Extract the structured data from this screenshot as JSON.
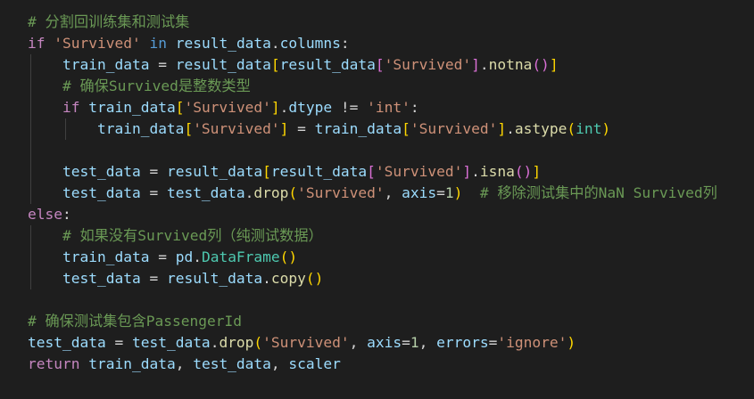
{
  "editor": {
    "language": "python",
    "theme": "dark",
    "colors": {
      "background": "#1e1e1e",
      "keyword": "#569cd6",
      "control": "#c586c0",
      "string": "#ce9178",
      "number": "#b5cea8",
      "variable": "#9cdcfe",
      "function": "#dcdcaa",
      "class": "#4ec9b0",
      "comment": "#6a9955",
      "bracket_level1": "#ffd700",
      "bracket_level2": "#da70d6"
    },
    "lines": [
      {
        "tokens": [
          {
            "t": "# 分割回训练集和测试集",
            "c": "cmt"
          }
        ]
      },
      {
        "tokens": [
          {
            "t": "if",
            "c": "ctl"
          },
          {
            "t": " ",
            "c": "op"
          },
          {
            "t": "'Survived'",
            "c": "str"
          },
          {
            "t": " ",
            "c": "op"
          },
          {
            "t": "in",
            "c": "kw"
          },
          {
            "t": " ",
            "c": "op"
          },
          {
            "t": "result_data",
            "c": "var"
          },
          {
            "t": ".",
            "c": "op"
          },
          {
            "t": "columns",
            "c": "var"
          },
          {
            "t": ":",
            "c": "op"
          }
        ]
      },
      {
        "tokens": [
          {
            "t": "    ",
            "c": "op"
          },
          {
            "t": "train_data",
            "c": "var"
          },
          {
            "t": " = ",
            "c": "op"
          },
          {
            "t": "result_data",
            "c": "var"
          },
          {
            "t": "[",
            "c": "b1"
          },
          {
            "t": "result_data",
            "c": "var"
          },
          {
            "t": "[",
            "c": "b2"
          },
          {
            "t": "'Survived'",
            "c": "str"
          },
          {
            "t": "]",
            "c": "b2"
          },
          {
            "t": ".",
            "c": "op"
          },
          {
            "t": "notna",
            "c": "fn"
          },
          {
            "t": "()",
            "c": "b2"
          },
          {
            "t": "]",
            "c": "b1"
          }
        ]
      },
      {
        "tokens": [
          {
            "t": "    ",
            "c": "op"
          },
          {
            "t": "# 确保Survived是整数类型",
            "c": "cmt"
          }
        ]
      },
      {
        "tokens": [
          {
            "t": "    ",
            "c": "op"
          },
          {
            "t": "if",
            "c": "ctl"
          },
          {
            "t": " ",
            "c": "op"
          },
          {
            "t": "train_data",
            "c": "var"
          },
          {
            "t": "[",
            "c": "b1"
          },
          {
            "t": "'Survived'",
            "c": "str"
          },
          {
            "t": "]",
            "c": "b1"
          },
          {
            "t": ".",
            "c": "op"
          },
          {
            "t": "dtype",
            "c": "var"
          },
          {
            "t": " != ",
            "c": "op"
          },
          {
            "t": "'int'",
            "c": "str"
          },
          {
            "t": ":",
            "c": "op"
          }
        ]
      },
      {
        "tokens": [
          {
            "t": "        ",
            "c": "op"
          },
          {
            "t": "train_data",
            "c": "var"
          },
          {
            "t": "[",
            "c": "b1"
          },
          {
            "t": "'Survived'",
            "c": "str"
          },
          {
            "t": "]",
            "c": "b1"
          },
          {
            "t": " = ",
            "c": "op"
          },
          {
            "t": "train_data",
            "c": "var"
          },
          {
            "t": "[",
            "c": "b1"
          },
          {
            "t": "'Survived'",
            "c": "str"
          },
          {
            "t": "]",
            "c": "b1"
          },
          {
            "t": ".",
            "c": "op"
          },
          {
            "t": "astype",
            "c": "fn"
          },
          {
            "t": "(",
            "c": "b1"
          },
          {
            "t": "int",
            "c": "cls"
          },
          {
            "t": ")",
            "c": "b1"
          }
        ]
      },
      {
        "tokens": []
      },
      {
        "tokens": [
          {
            "t": "    ",
            "c": "op"
          },
          {
            "t": "test_data",
            "c": "var"
          },
          {
            "t": " = ",
            "c": "op"
          },
          {
            "t": "result_data",
            "c": "var"
          },
          {
            "t": "[",
            "c": "b1"
          },
          {
            "t": "result_data",
            "c": "var"
          },
          {
            "t": "[",
            "c": "b2"
          },
          {
            "t": "'Survived'",
            "c": "str"
          },
          {
            "t": "]",
            "c": "b2"
          },
          {
            "t": ".",
            "c": "op"
          },
          {
            "t": "isna",
            "c": "fn"
          },
          {
            "t": "()",
            "c": "b2"
          },
          {
            "t": "]",
            "c": "b1"
          }
        ]
      },
      {
        "tokens": [
          {
            "t": "    ",
            "c": "op"
          },
          {
            "t": "test_data",
            "c": "var"
          },
          {
            "t": " = ",
            "c": "op"
          },
          {
            "t": "test_data",
            "c": "var"
          },
          {
            "t": ".",
            "c": "op"
          },
          {
            "t": "drop",
            "c": "fn"
          },
          {
            "t": "(",
            "c": "b1"
          },
          {
            "t": "'Survived'",
            "c": "str"
          },
          {
            "t": ", ",
            "c": "op"
          },
          {
            "t": "axis",
            "c": "var"
          },
          {
            "t": "=",
            "c": "op"
          },
          {
            "t": "1",
            "c": "num"
          },
          {
            "t": ")",
            "c": "b1"
          },
          {
            "t": "  ",
            "c": "op"
          },
          {
            "t": "# 移除测试集中的NaN Survived列",
            "c": "cmt"
          }
        ]
      },
      {
        "tokens": [
          {
            "t": "else",
            "c": "ctl"
          },
          {
            "t": ":",
            "c": "op"
          }
        ]
      },
      {
        "tokens": [
          {
            "t": "    ",
            "c": "op"
          },
          {
            "t": "# 如果没有Survived列（纯测试数据）",
            "c": "cmt"
          }
        ]
      },
      {
        "tokens": [
          {
            "t": "    ",
            "c": "op"
          },
          {
            "t": "train_data",
            "c": "var"
          },
          {
            "t": " = ",
            "c": "op"
          },
          {
            "t": "pd",
            "c": "var"
          },
          {
            "t": ".",
            "c": "op"
          },
          {
            "t": "DataFrame",
            "c": "cls"
          },
          {
            "t": "()",
            "c": "b1"
          }
        ]
      },
      {
        "tokens": [
          {
            "t": "    ",
            "c": "op"
          },
          {
            "t": "test_data",
            "c": "var"
          },
          {
            "t": " = ",
            "c": "op"
          },
          {
            "t": "result_data",
            "c": "var"
          },
          {
            "t": ".",
            "c": "op"
          },
          {
            "t": "copy",
            "c": "fn"
          },
          {
            "t": "()",
            "c": "b1"
          }
        ]
      },
      {
        "tokens": []
      },
      {
        "tokens": [
          {
            "t": "# 确保测试集包含PassengerId",
            "c": "cmt"
          }
        ]
      },
      {
        "tokens": [
          {
            "t": "test_data",
            "c": "var"
          },
          {
            "t": " = ",
            "c": "op"
          },
          {
            "t": "test_data",
            "c": "var"
          },
          {
            "t": ".",
            "c": "op"
          },
          {
            "t": "drop",
            "c": "fn"
          },
          {
            "t": "(",
            "c": "b1"
          },
          {
            "t": "'Survived'",
            "c": "str"
          },
          {
            "t": ", ",
            "c": "op"
          },
          {
            "t": "axis",
            "c": "var"
          },
          {
            "t": "=",
            "c": "op"
          },
          {
            "t": "1",
            "c": "num"
          },
          {
            "t": ", ",
            "c": "op"
          },
          {
            "t": "errors",
            "c": "var"
          },
          {
            "t": "=",
            "c": "op"
          },
          {
            "t": "'ignore'",
            "c": "str"
          },
          {
            "t": ")",
            "c": "b1"
          }
        ]
      },
      {
        "tokens": [
          {
            "t": "return",
            "c": "ctl"
          },
          {
            "t": " ",
            "c": "op"
          },
          {
            "t": "train_data",
            "c": "var"
          },
          {
            "t": ", ",
            "c": "op"
          },
          {
            "t": "test_data",
            "c": "var"
          },
          {
            "t": ", ",
            "c": "op"
          },
          {
            "t": "scaler",
            "c": "var"
          }
        ]
      }
    ]
  }
}
